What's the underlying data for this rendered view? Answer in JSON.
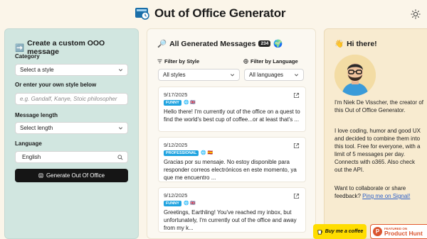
{
  "header": {
    "title": "Out of Office Generator"
  },
  "left": {
    "title": "Create a custom OOO message",
    "title_icon": "➡️",
    "category_label": "Category",
    "category_value": "Select a style",
    "own_style_label": "Or enter your own style below",
    "own_style_placeholder": "e.g. Gandalf, Kanye, Stoic philosopher",
    "length_label": "Message length",
    "length_value": "Select length",
    "language_label": "Language",
    "language_value": "English",
    "generate_label": "Generate Out Of Office"
  },
  "middle": {
    "title": "All Generated Messages",
    "title_icon": "🔎",
    "count": "234",
    "globe": "🌍",
    "filter_style_label": "Filter by Style",
    "filter_style_value": "All styles",
    "filter_lang_label": "Filter by Language",
    "filter_lang_value": "All languages",
    "cards": [
      {
        "date": "9/17/2025",
        "tag": "FUNNY",
        "tag_color": "#1fa3e0",
        "flags": "🌐 🇬🇧",
        "text": "Hello there! I'm currently out of the office on a quest to find the world's best cup of coffee...or at least that's ..."
      },
      {
        "date": "9/12/2025",
        "tag": "PROFESSIONAL",
        "tag_color": "#1fa3e0",
        "flags": "🌐 🇪🇸",
        "text": "Gracias por su mensaje. No estoy disponible para responder correos electrónicos en este momento, ya que me encuentro ..."
      },
      {
        "date": "9/12/2025",
        "tag": "FUNNY",
        "tag_color": "#1fa3e0",
        "flags": "🌐 🇬🇧",
        "text": "Greetings, Earthling! You've reached my inbox, but unfortunately, I'm currently out of the office and away from my k..."
      }
    ]
  },
  "right": {
    "title": "Hi there!",
    "title_icon": "👋",
    "bio1": "I'm Niek De Visscher, the creator of this Out of Office Generator.",
    "bio2": "I love coding, humor and good UX and decided to combine them into this tool. Free for everyone, with a limit of 5 messages per day. Connects with o365. Also check out the API.",
    "bio3_prefix": "Want to collaborate or share feedback?",
    "bio3_link": "Ping me on Signal!"
  },
  "badges": {
    "bmc_label": "Buy me a coffee",
    "ph_small": "FEATURED ON",
    "ph_big": "Product Hunt",
    "ph_letter": "P"
  },
  "colors": {
    "accent_teal": "#d1e6e0",
    "accent_sand": "#f8ebd0",
    "tag_blue": "#1fa3e0",
    "button_dark": "#151515"
  }
}
